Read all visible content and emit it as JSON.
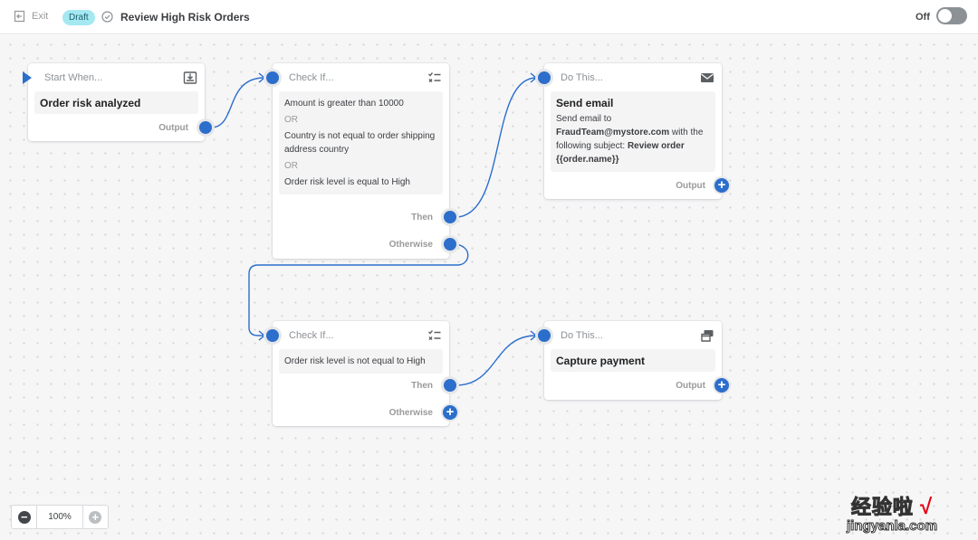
{
  "header": {
    "exit_label": "Exit",
    "status_badge": "Draft",
    "workflow_title": "Review High Risk Orders",
    "toggle_label": "Off",
    "toggle_on": false
  },
  "nodes": {
    "start": {
      "header": "Start When...",
      "icon": "download-tray-icon",
      "trigger": "Order risk analyzed",
      "output_label": "Output"
    },
    "check1": {
      "header": "Check If...",
      "icon": "checklist-icon",
      "conditions": [
        "Amount is greater than 10000",
        "Country is not equal to order shipping address country",
        "Order risk level is equal to High"
      ],
      "operator": "OR",
      "then_label": "Then",
      "otherwise_label": "Otherwise"
    },
    "action1": {
      "header": "Do This...",
      "icon": "envelope-icon",
      "title": "Send email",
      "desc_prefix": "Send email to ",
      "desc_email": "FraudTeam@mystore.com",
      "desc_middle": " with the following subject: ",
      "desc_subject": "Review order {{order.name}}",
      "output_label": "Output"
    },
    "check2": {
      "header": "Check If...",
      "icon": "checklist-icon",
      "conditions": [
        "Order risk level is not equal to High"
      ],
      "then_label": "Then",
      "otherwise_label": "Otherwise"
    },
    "action2": {
      "header": "Do This...",
      "icon": "credit-card-icon",
      "title": "Capture payment",
      "output_label": "Output"
    }
  },
  "zoom": {
    "value": "100%"
  },
  "watermark": {
    "line1": "经验啦",
    "check": "√",
    "line2": "jingyanla.com"
  },
  "colors": {
    "accent": "#2c6ecb",
    "badge": "#a4e8f2",
    "canvas": "#f6f6f7"
  }
}
